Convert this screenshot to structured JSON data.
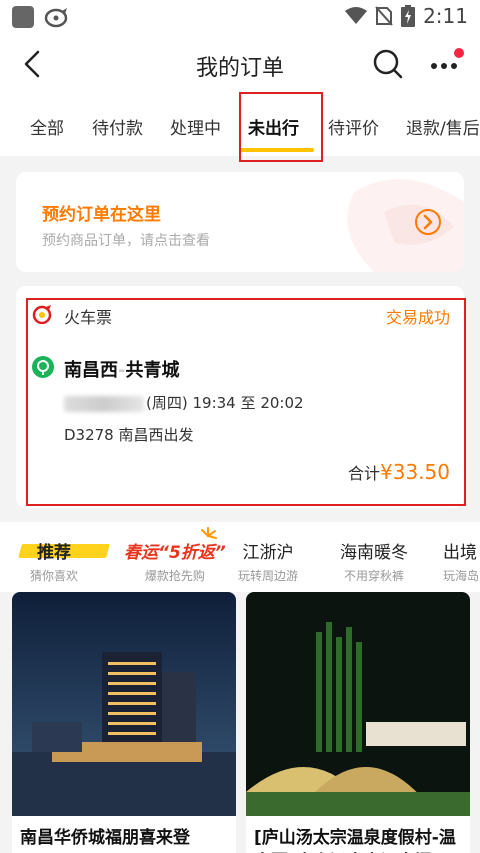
{
  "status_bar": {
    "time": "2:11",
    "icons": [
      "app-square-icon",
      "bird-icon",
      "wifi-icon",
      "no-sim-icon",
      "battery-charging-icon"
    ]
  },
  "header": {
    "title": "我的订单",
    "back_icon": "chevron-left-icon",
    "search_icon": "search-icon",
    "more_icon": "more-icon"
  },
  "tabs": [
    {
      "label": "全部"
    },
    {
      "label": "待付款"
    },
    {
      "label": "处理中"
    },
    {
      "label": "未出行"
    },
    {
      "label": "待评价"
    },
    {
      "label": "退款/售后"
    }
  ],
  "active_tab": "未出行",
  "booking_banner": {
    "title": "预约订单在这里",
    "subtitle": "预约商品订单，请点击查看"
  },
  "order": {
    "type": "火车票",
    "status": "交易成功",
    "from": "南昌西",
    "to": "共青城",
    "route_separator": "-",
    "weekday": "(周四)",
    "depart_time": "19:34",
    "time_separator": "至",
    "arrive_time": "20:02",
    "train_info": "D3278 南昌西出发",
    "total_label": "合计",
    "total_price": "¥33.50"
  },
  "recommend_tabs": [
    {
      "main": "推荐",
      "sub": "猜你喜欢"
    },
    {
      "main": "春运“5折返”",
      "sub": "爆款抢先购"
    },
    {
      "main": "江浙沪",
      "sub": "玩转周边游"
    },
    {
      "main": "海南暖冬",
      "sub": "不用穿秋裤"
    },
    {
      "main": "出境",
      "sub": "玩海岛"
    }
  ],
  "products": [
    {
      "title": "南昌华侨城福朋喜来登"
    },
    {
      "title": "[庐山汤太宗温泉度假村-温泉票]庐山汤太宗温泉门"
    }
  ],
  "colors": {
    "accent_orange": "#ff7a00",
    "tab_underline": "#ffc300",
    "highlight_red": "#e02020"
  }
}
